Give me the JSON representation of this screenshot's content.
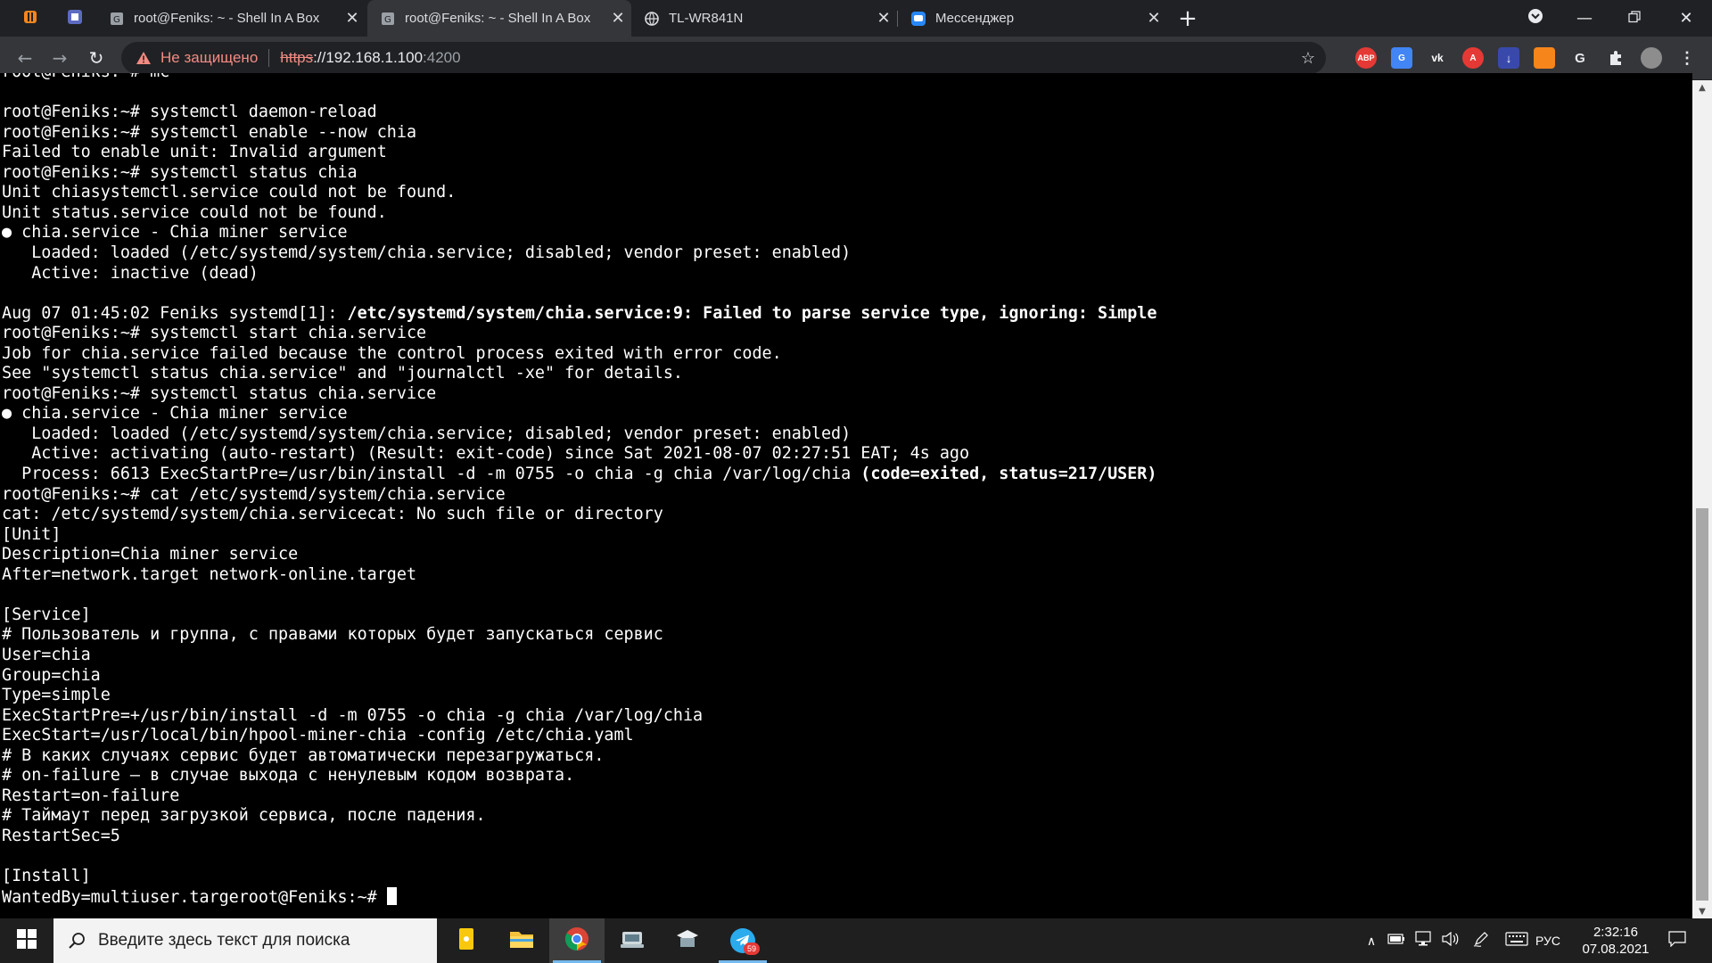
{
  "tabs": [
    {
      "title": "root@Feniks: ~ - Shell In A Box",
      "icon": "shellinabox-icon",
      "active": false
    },
    {
      "title": "root@Feniks: ~ - Shell In A Box",
      "icon": "shellinabox-icon",
      "active": true
    },
    {
      "title": "TL-WR841N",
      "icon": "globe-icon",
      "active": false
    },
    {
      "title": "Мессенджер",
      "icon": "vk-messenger-icon",
      "active": false
    }
  ],
  "address_bar": {
    "security_label": "Не защищено",
    "scheme": "https",
    "separator": "://",
    "host": "192.168.1.100",
    "port": ":4200"
  },
  "extensions": [
    "ABP",
    "G",
    "vk",
    "A",
    "↓",
    "",
    "G",
    "",
    ""
  ],
  "terminal": {
    "lines": [
      [
        {
          "t": "root@Feniks:~# mc"
        }
      ],
      [
        {
          "t": ""
        }
      ],
      [
        {
          "t": "root@Feniks:~# systemctl daemon-reload"
        }
      ],
      [
        {
          "t": "root@Feniks:~# systemctl enable --now chia"
        }
      ],
      [
        {
          "t": "Failed to enable unit: Invalid argument"
        }
      ],
      [
        {
          "t": "root@Feniks:~# systemctl status chia"
        }
      ],
      [
        {
          "t": "Unit chiasystemctl.service could not be found."
        }
      ],
      [
        {
          "t": "Unit status.service could not be found."
        }
      ],
      [
        {
          "t": "● chia.service - Chia miner service"
        }
      ],
      [
        {
          "t": "   Loaded: loaded (/etc/systemd/system/chia.service; disabled; vendor preset: enabled)"
        }
      ],
      [
        {
          "t": "   Active: inactive (dead)"
        }
      ],
      [
        {
          "t": ""
        }
      ],
      [
        {
          "t": "Aug 07 01:45:02 Feniks systemd[1]: "
        },
        {
          "t": "/etc/systemd/system/chia.service:9: Failed to parse service type, ignoring: Simple",
          "b": true
        }
      ],
      [
        {
          "t": "root@Feniks:~# systemctl start chia.service"
        }
      ],
      [
        {
          "t": "Job for chia.service failed because the control process exited with error code."
        }
      ],
      [
        {
          "t": "See \"systemctl status chia.service\" and \"journalctl -xe\" for details."
        }
      ],
      [
        {
          "t": "root@Feniks:~# systemctl status chia.service"
        }
      ],
      [
        {
          "t": "● chia.service - Chia miner service"
        }
      ],
      [
        {
          "t": "   Loaded: loaded (/etc/systemd/system/chia.service; disabled; vendor preset: enabled)"
        }
      ],
      [
        {
          "t": "   Active: activating (auto-restart) (Result: exit-code) since Sat 2021-08-07 02:27:51 EAT; 4s ago"
        }
      ],
      [
        {
          "t": "  Process: 6613 ExecStartPre=/usr/bin/install -d -m 0755 -o chia -g chia /var/log/chia "
        },
        {
          "t": "(code=exited, status=217/USER)",
          "b": true
        }
      ],
      [
        {
          "t": "root@Feniks:~# cat /etc/systemd/system/chia.service"
        }
      ],
      [
        {
          "t": "cat: /etc/systemd/system/chia.servicecat: No such file or directory"
        }
      ],
      [
        {
          "t": "[Unit]"
        }
      ],
      [
        {
          "t": "Description=Chia miner service"
        }
      ],
      [
        {
          "t": "After=network.target network-online.target"
        }
      ],
      [
        {
          "t": ""
        }
      ],
      [
        {
          "t": "[Service]"
        }
      ],
      [
        {
          "t": "# Пользователь и группа, с правами которых будет запускаться сервис"
        }
      ],
      [
        {
          "t": "User=chia"
        }
      ],
      [
        {
          "t": "Group=chia"
        }
      ],
      [
        {
          "t": "Type=simple"
        }
      ],
      [
        {
          "t": "ExecStartPre=+/usr/bin/install -d -m 0755 -o chia -g chia /var/log/chia"
        }
      ],
      [
        {
          "t": "ExecStart=/usr/local/bin/hpool-miner-chia -config /etc/chia.yaml"
        }
      ],
      [
        {
          "t": "# В каких случаях сервис будет автоматически перезагружаться."
        }
      ],
      [
        {
          "t": "# on-failure — в случае выхода с ненулевым кодом возврата."
        }
      ],
      [
        {
          "t": "Restart=on-failure"
        }
      ],
      [
        {
          "t": "# Таймаут перед загрузкой сервиса, после падения."
        }
      ],
      [
        {
          "t": "RestartSec=5"
        }
      ],
      [
        {
          "t": ""
        }
      ],
      [
        {
          "t": "[Install]"
        }
      ],
      [
        {
          "t": "WantedBy=multiuser.targeroot@Feniks:~# ",
          "cursor": true
        }
      ]
    ]
  },
  "taskbar": {
    "search_placeholder": "Введите здесь текст для поиска",
    "apps": [
      {
        "name": "sticky-notes-icon",
        "active": false
      },
      {
        "name": "file-explorer-icon",
        "active": false
      },
      {
        "name": "chrome-icon",
        "active": true
      },
      {
        "name": "network-scanner-icon",
        "active": false
      },
      {
        "name": "graduation-app-icon",
        "active": false
      },
      {
        "name": "telegram-icon",
        "active": false,
        "badge": "59"
      }
    ],
    "language": "РУС",
    "time": "2:32:16",
    "date": "07.08.2021"
  },
  "colors": {
    "tabstrip": "#202124",
    "toolbar": "#35363a",
    "terminal_bg": "#000000",
    "terminal_fg": "#ffffff",
    "insecure": "#f28b82",
    "taskbar": "#1f1f1f"
  }
}
